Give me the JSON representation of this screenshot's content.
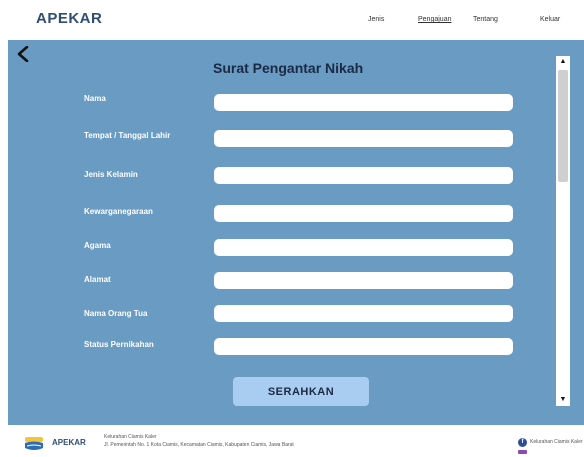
{
  "nav": {
    "brand": "APEKAR",
    "links": [
      "Jenis",
      "Pengajuan",
      "Tentang",
      "Keluar"
    ]
  },
  "form": {
    "title": "Surat Pengantar Nikah",
    "fields": [
      {
        "label": "Nama",
        "value": ""
      },
      {
        "label": "Tempat / Tanggal Lahir",
        "value": ""
      },
      {
        "label": "Jenis Kelamin",
        "value": ""
      },
      {
        "label": "Kewarganegaraan",
        "value": ""
      },
      {
        "label": "Agama",
        "value": ""
      },
      {
        "label": "Alamat",
        "value": ""
      },
      {
        "label": "Nama Orang Tua",
        "value": ""
      },
      {
        "label": "Status Pernikahan",
        "value": ""
      }
    ],
    "submit_label": "SERAHKAN"
  },
  "footer": {
    "brand": "APEKAR",
    "line1": "Kelurahan Ciamis Kaler",
    "line2": "Jl. Pemerintah No. 1 Kota Ciamis, Kecamatan Ciamis, Kabupaten Ciamis, Jawa Barat",
    "social_text": "Kelurahan Ciamis Kaler"
  },
  "colors": {
    "panel": "#6a9bc3",
    "brand": "#2e4e74",
    "submit": "#a9cdf0"
  },
  "icons": {
    "back": "arrow-left-icon",
    "logo": "city-logo-icon",
    "social": "facebook-icon"
  }
}
